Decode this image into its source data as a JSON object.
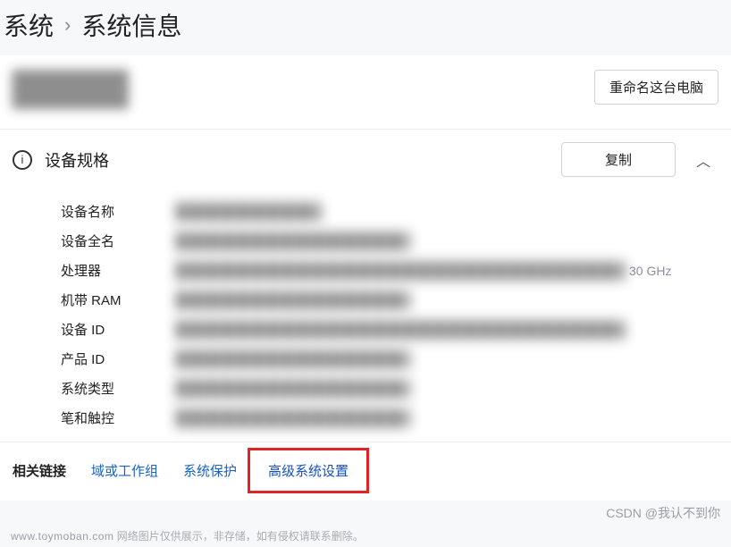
{
  "breadcrumb": {
    "parent": "系统",
    "current": "系统信息"
  },
  "header": {
    "rename_btn": "重命名这台电脑"
  },
  "device_specs": {
    "title": "设备规格",
    "copy_btn": "复制",
    "rows": {
      "device_name": "设备名称",
      "full_name": "设备全名",
      "cpu": "处理器",
      "cpu_suffix": "30 GHz",
      "ram": "机带 RAM",
      "device_id": "设备 ID",
      "product_id": "产品 ID",
      "sys_type": "系统类型",
      "pen_touch": "笔和触控"
    }
  },
  "links": {
    "head": "相关链接",
    "domain": "域或工作组",
    "protect": "系统保护",
    "advanced": "高级系统设置"
  },
  "watermark": "CSDN @我认不到你",
  "footnote_domain": "www.toymoban.com",
  "footnote_text": "网络图片仅供展示，非存储，如有侵权请联系删除。"
}
